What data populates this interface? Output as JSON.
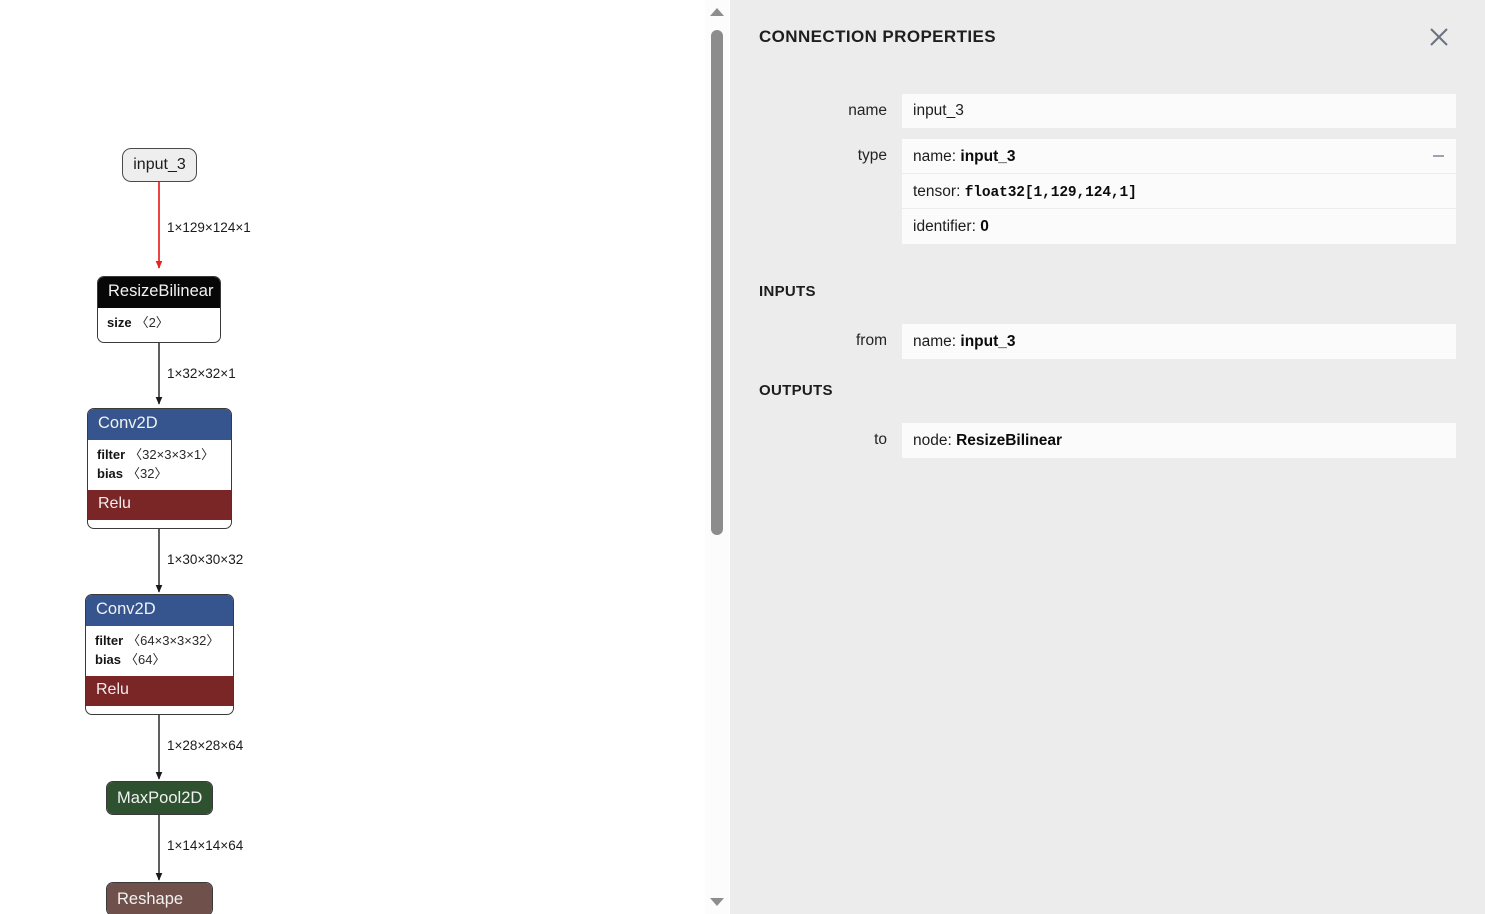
{
  "graph": {
    "nodes": [
      {
        "id": "input_3",
        "kind": "io",
        "title": "input_3"
      },
      {
        "id": "ResizeBilinear",
        "kind": "op",
        "title": "ResizeBilinear",
        "header_color": "#070707",
        "attributes": [
          {
            "key": "size",
            "value": "〈2〉"
          }
        ]
      },
      {
        "id": "Conv2D_1",
        "kind": "op",
        "title": "Conv2D",
        "header_color": "#36558e",
        "attributes": [
          {
            "key": "filter",
            "value": "〈32×3×3×1〉"
          },
          {
            "key": "bias",
            "value": "〈32〉"
          }
        ],
        "footer": "Relu",
        "footer_color": "#7b2626"
      },
      {
        "id": "Conv2D_2",
        "kind": "op",
        "title": "Conv2D",
        "header_color": "#36558e",
        "attributes": [
          {
            "key": "filter",
            "value": "〈64×3×3×32〉"
          },
          {
            "key": "bias",
            "value": "〈64〉"
          }
        ],
        "footer": "Relu",
        "footer_color": "#7b2626"
      },
      {
        "id": "MaxPool2D",
        "kind": "op",
        "title": "MaxPool2D",
        "header_color": "#2e5130"
      },
      {
        "id": "Reshape",
        "kind": "op",
        "title": "Reshape",
        "header_color": "#70504a"
      }
    ],
    "edges": [
      {
        "from": "input_3",
        "to": "ResizeBilinear",
        "label": "1×129×124×1",
        "color": "#e8231f",
        "highlighted": true
      },
      {
        "from": "ResizeBilinear",
        "to": "Conv2D_1",
        "label": "1×32×32×1",
        "color": "#1a1a1a",
        "highlighted": false
      },
      {
        "from": "Conv2D_1",
        "to": "Conv2D_2",
        "label": "1×30×30×32",
        "color": "#1a1a1a",
        "highlighted": false
      },
      {
        "from": "Conv2D_2",
        "to": "MaxPool2D",
        "label": "1×28×28×64",
        "color": "#1a1a1a",
        "highlighted": false
      },
      {
        "from": "MaxPool2D",
        "to": "Reshape",
        "label": "1×14×14×64",
        "color": "#1a1a1a",
        "highlighted": false
      }
    ]
  },
  "scrollbar": {
    "up_arrow_icon": "triangle-up-icon",
    "down_arrow_icon": "triangle-down-icon"
  },
  "panel": {
    "title": "CONNECTION PROPERTIES",
    "close_icon": "close-icon",
    "fields": [
      {
        "label": "name",
        "type": "text",
        "value": "input_3"
      },
      {
        "label": "type",
        "type": "kv",
        "collapsible": true,
        "rows": [
          {
            "key": "name:",
            "value": "input_3",
            "mono": false
          },
          {
            "key": "tensor:",
            "value": "float32[1,129,124,1]",
            "mono": true
          },
          {
            "key": "identifier:",
            "value": "0",
            "mono": false
          }
        ]
      }
    ],
    "sections": [
      {
        "title": "INPUTS",
        "fields": [
          {
            "label": "from",
            "type": "kv",
            "rows": [
              {
                "key": "name:",
                "value": "input_3",
                "mono": false
              }
            ]
          }
        ]
      },
      {
        "title": "OUTPUTS",
        "fields": [
          {
            "label": "to",
            "type": "kv",
            "rows": [
              {
                "key": "node:",
                "value": "ResizeBilinear",
                "mono": false
              }
            ]
          }
        ]
      }
    ]
  },
  "colors": {
    "panel_background": "#ececec",
    "field_background": "#fbfbfb",
    "canvas_background": "#ffffff",
    "highlight_edge": "#e8231f",
    "scrollbar_thumb": "#8c8c8c"
  }
}
